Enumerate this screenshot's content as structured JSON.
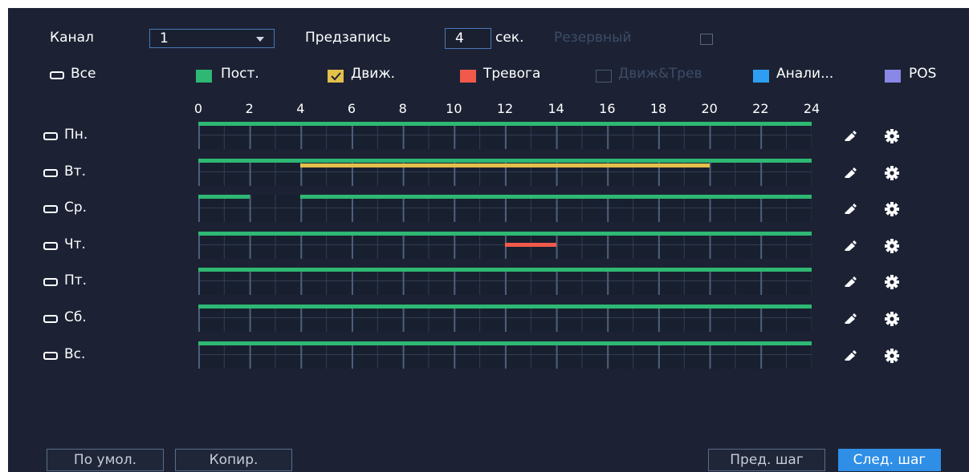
{
  "header": {
    "channel_label": "Канал",
    "channel_value": "1",
    "prerecord_label": "Предзапись",
    "prerecord_value": "4",
    "prerecord_unit": "сек.",
    "reserve_label": "Резервный"
  },
  "legend": {
    "all_label": "Все",
    "items": [
      {
        "label": "Пост.",
        "color": "#2eb873"
      },
      {
        "label": "Движ.",
        "color": "#e3c04a"
      },
      {
        "label": "Тревога",
        "color": "#f15a4a"
      },
      {
        "label": "Движ&Трев",
        "color": "#1c2234"
      },
      {
        "label": "Анали...",
        "color": "#2e9ef2"
      },
      {
        "label": "POS",
        "color": "#8a87e6"
      }
    ]
  },
  "axis": {
    "ticks": [
      "0",
      "2",
      "4",
      "6",
      "8",
      "10",
      "12",
      "14",
      "16",
      "18",
      "20",
      "22",
      "24"
    ]
  },
  "days": [
    {
      "label": "Пн.",
      "segments": [
        {
          "type": "Пост.",
          "start": 0,
          "end": 24,
          "lane": "top"
        }
      ]
    },
    {
      "label": "Вт.",
      "segments": [
        {
          "type": "Пост.",
          "start": 0,
          "end": 24,
          "lane": "top"
        },
        {
          "type": "Движ.",
          "start": 4,
          "end": 20,
          "lane": "top2"
        }
      ]
    },
    {
      "label": "Ср.",
      "segments": [
        {
          "type": "Пост.",
          "start": 0,
          "end": 2,
          "lane": "top"
        },
        {
          "type": "Пост.",
          "start": 4,
          "end": 24,
          "lane": "top"
        }
      ]
    },
    {
      "label": "Чт.",
      "segments": [
        {
          "type": "Пост.",
          "start": 0,
          "end": 24,
          "lane": "top"
        },
        {
          "type": "Тревога",
          "start": 12,
          "end": 14,
          "lane": "mid"
        }
      ]
    },
    {
      "label": "Пт.",
      "segments": [
        {
          "type": "Пост.",
          "start": 0,
          "end": 24,
          "lane": "top"
        }
      ]
    },
    {
      "label": "Сб.",
      "segments": [
        {
          "type": "Пост.",
          "start": 0,
          "end": 24,
          "lane": "top"
        }
      ]
    },
    {
      "label": "Вс.",
      "segments": [
        {
          "type": "Пост.",
          "start": 0,
          "end": 24,
          "lane": "top"
        }
      ]
    }
  ],
  "footer": {
    "default_label": "По умол.",
    "copy_label": "Копир.",
    "prev_label": "Пред. шаг",
    "next_label": "След. шаг"
  }
}
